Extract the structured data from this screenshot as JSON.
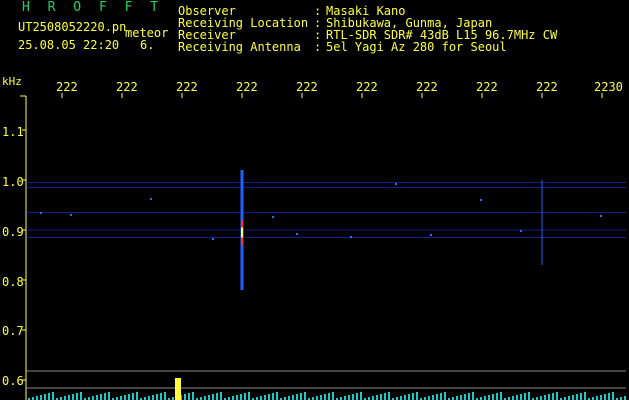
{
  "header": {
    "brand": "H R O F F T",
    "file_name": "UT2508052220.pn",
    "file_type": "meteor",
    "date_time": "25.08.05 22:20",
    "count": "6.",
    "fields": [
      {
        "label": "Observer",
        "value": "Masaki Kano"
      },
      {
        "label": "Receiving Location",
        "value": "Shibukawa, Gunma, Japan"
      },
      {
        "label": "Receiver",
        "value": "RTL-SDR SDR# 43dB L15 96.7MHz CW"
      },
      {
        "label": "Receiving Antenna",
        "value": "5el Yagi Az 280 for Seoul"
      }
    ],
    "colon": ":"
  },
  "colors": {
    "text": "#ffff40",
    "brand": "#20d060",
    "background": "#000000",
    "signal": "#2060ff"
  },
  "chart_data": {
    "type": "heatmap",
    "ylabel": "kHz",
    "x_ticks": [
      "222",
      "222",
      "222",
      "222",
      "222",
      "222",
      "222",
      "222",
      "222",
      "2230"
    ],
    "y_ticks": [
      "1.1",
      "1.0",
      "0.9",
      "0.8",
      "0.7",
      "0.6"
    ],
    "ylim": [
      0.6,
      1.1
    ],
    "horizontal_traces_khz": [
      0.995,
      0.985,
      0.935,
      0.9,
      0.885
    ],
    "meteor_events": [
      {
        "x": 222.3,
        "y_from": 0.78,
        "y_to": 1.02,
        "strength": "strong"
      },
      {
        "x": 222.8,
        "y_from": 0.83,
        "y_to": 1.0,
        "strength": "weak"
      }
    ]
  }
}
